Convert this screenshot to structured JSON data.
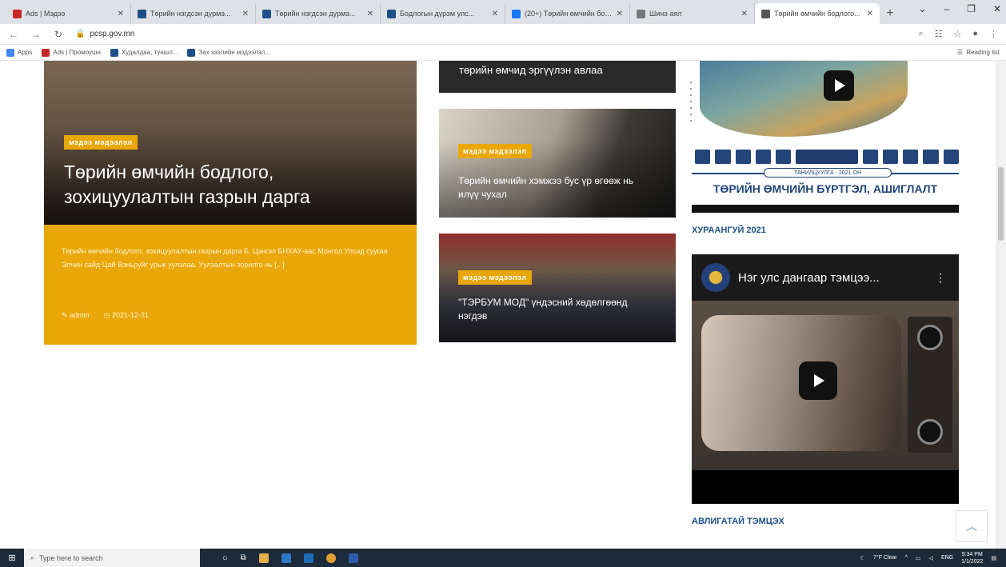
{
  "browser": {
    "tabs": [
      {
        "title": "Ads | Мэдээ",
        "color": "#c62828"
      },
      {
        "title": "Төрийн нэгдсэн дүрмэ...",
        "color": "#1e4f8a"
      },
      {
        "title": "Төрийн нэгдсэн дүрмэ...",
        "color": "#1e4f8a"
      },
      {
        "title": "Бодлогын дүрэм улс...",
        "color": "#1e4f8a"
      },
      {
        "title": "(20+) Төрийн өмчийн бодлого...",
        "color": "#1877f2"
      },
      {
        "title": "Шинэ аял",
        "color": "#777777"
      },
      {
        "title": "Төрийн өмчийн бодлого...",
        "color": "#555555",
        "active": true
      }
    ],
    "url": "pcsp.gov.mn",
    "bookmarks": [
      {
        "label": "Apps",
        "color": "#4285f4"
      },
      {
        "label": "Ads | Промоушн",
        "color": "#c62828"
      },
      {
        "label": "Худалдаа, түншл...",
        "color": "#1e4f8a"
      },
      {
        "label": "Зах зээлийн мэдээлэл...",
        "color": "#1e4f8a"
      }
    ],
    "reading_list": "Reading list"
  },
  "main_article": {
    "badge": "мэдээ мэдээлэл",
    "title": "Төрийн өмчийн бодлого, зохицуулалтын газрын дарга",
    "excerpt": "Төрийн өмчийн бодлого, зохицуулалтын газрын дарга Б. Цэнгэл БНХАУ-аас Монгол Улсад суугаа Элчин сайд Цай Вэньруйг урьж уулзлаа. Уулзалтын зорилго нь [...]",
    "author": "admin",
    "date": "2021-12-31"
  },
  "side_articles": [
    {
      "title": "төрийн өмчид эргүүлэн авлаа"
    },
    {
      "badge": "мэдээ мэдээлэл",
      "title": "Төрийн өмчийн хэмжээ бус үр өгөөж нь илүү чухал"
    },
    {
      "badge": "мэдээ мэдээлэл",
      "title": "\"ТЭРБУМ МОД\" үндэсний хөдөлгөөнд нэгдэв"
    }
  ],
  "sidebar": {
    "banner_year": "ТАНИЛЦУУЛГА · 2021 ОН",
    "banner_title": "ТӨРИЙН ӨМЧИЙН БҮРТГЭЛ, АШИГЛАЛТ",
    "label1": "ХУРААНГУЙ 2021",
    "video_title": "Нэг улс дангаар тэмцээ...",
    "label2": "АВЛИГАТАЙ ТЭМЦЭХ"
  },
  "taskbar": {
    "search_placeholder": "Type here to search",
    "weather": "7°F Clear",
    "lang": "ENG",
    "time": "9:34 PM",
    "date": "1/1/2022"
  }
}
